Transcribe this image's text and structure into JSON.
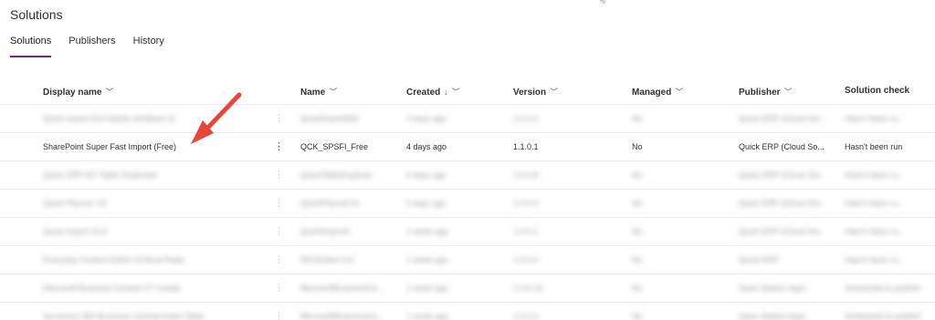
{
  "page": {
    "title": "Solutions"
  },
  "tabs": [
    {
      "label": "Solutions",
      "active": true
    },
    {
      "label": "Publishers",
      "active": false
    },
    {
      "label": "History",
      "active": false
    }
  ],
  "columns": {
    "display_name": "Display name",
    "name": "Name",
    "created": "Created",
    "version": "Version",
    "managed": "Managed",
    "publisher": "Publisher",
    "solution_check": "Solution check"
  },
  "rows": [
    {
      "display_name": "Quick Import Erd Native (Antifeed 2)",
      "name": "QuickImport809",
      "created": "3 days ago",
      "version": "1.0.0.2",
      "managed": "No",
      "publisher": "Quick ERP (Cloud Sol...",
      "solution_check": "Hasn't been ru...",
      "blurred": true
    },
    {
      "display_name": "SharePoint Super Fast Import (Free)",
      "name": "QCK_SPSFI_Free",
      "created": "4 days ago",
      "version": "1.1.0.1",
      "managed": "No",
      "publisher": "Quick ERP (Cloud So...",
      "solution_check": "Hasn't been run",
      "blurred": false
    },
    {
      "display_name": "Quick ERP DC Table Duplicator",
      "name": "QuickTableDuplicat...",
      "created": "5 days ago",
      "version": "1.0.0.8",
      "managed": "No",
      "publisher": "Quick ERP (Cloud Sol...",
      "solution_check": "Hasn't been ru...",
      "blurred": true
    },
    {
      "display_name": "Quick Planner V2",
      "name": "QuickPlannerV2",
      "created": "5 days ago",
      "version": "1.0.0.3",
      "managed": "No",
      "publisher": "Quick ERP (Cloud Sol...",
      "solution_check": "Hasn't been ru...",
      "blurred": true
    },
    {
      "display_name": "Quick Import XLS",
      "name": "QuickImportX",
      "created": "1 week ago",
      "version": "1.0.0.1",
      "managed": "No",
      "publisher": "Quick ERP (Cloud Sol...",
      "solution_check": "Hasn't been ru...",
      "blurred": true
    },
    {
      "display_name": "Everyday Content Editor (Critical Rate)",
      "name": "RDVEditor.Crit",
      "created": "1 week ago",
      "version": "1.0.0.4",
      "managed": "No",
      "publisher": "Quick ERP",
      "solution_check": "Hasn't been ru...",
      "blurred": true
    },
    {
      "display_name": "Microsoft Business Central CT Create",
      "name": "MicrosoftBusinessCe...",
      "created": "1 week ago",
      "version": "1.0.0.15",
      "managed": "No",
      "publisher": "Dave Stebon Appl...",
      "solution_check": "Scheduled to publish",
      "blurred": true
    },
    {
      "display_name": "Dynamics 365 Business Central Insert Table",
      "name": "MicrosoftBusinessCe...",
      "created": "1 week ago",
      "version": "1.0.0.2",
      "managed": "No",
      "publisher": "Dave Stebon Appl...",
      "solution_check": "Scheduled to publish",
      "blurred": true
    }
  ],
  "colors": {
    "accent": "#742774",
    "arrow": "#e8463a"
  },
  "icons": {
    "sort_desc": "arrow-down-icon",
    "chevron": "chevron-down-icon",
    "more": "more-vertical-icon"
  }
}
